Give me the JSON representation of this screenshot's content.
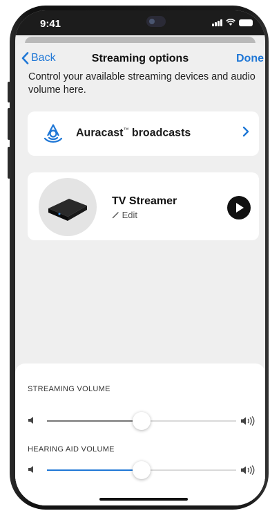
{
  "status_bar": {
    "time": "9:41"
  },
  "nav": {
    "back_label": "Back",
    "title": "Streaming options",
    "done_label": "Done"
  },
  "intro_text": "Control your available streaming devices and audio volume here.",
  "auracast": {
    "label": "Auracast",
    "trademark": "™",
    "label_suffix": " broadcasts",
    "icon": "auracast-icon"
  },
  "tv_streamer": {
    "name": "TV Streamer",
    "edit_label": "Edit",
    "edit_icon": "pencil-icon",
    "play_icon": "play-icon"
  },
  "volume": {
    "streaming": {
      "label": "STREAMING VOLUME",
      "level": 0.5,
      "fill_color": "#777777"
    },
    "hearing_aid": {
      "label": "HEARING AID VOLUME",
      "level": 0.5,
      "fill_color": "#1f77d6"
    }
  },
  "colors": {
    "accent": "#1f77d6"
  }
}
